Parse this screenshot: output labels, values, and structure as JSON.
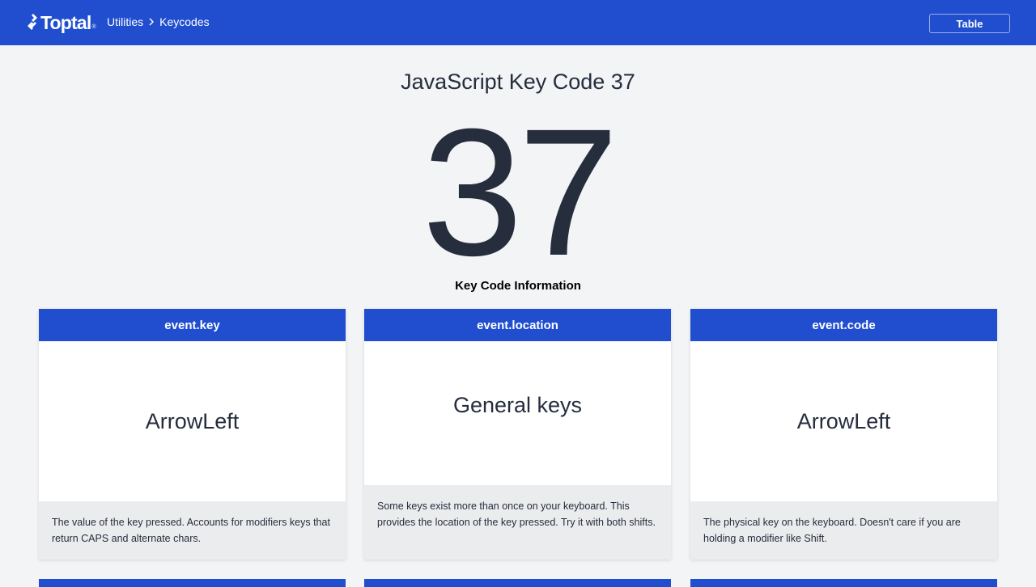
{
  "header": {
    "logo_text": "Toptal",
    "logo_reg": "®",
    "breadcrumb": [
      "Utilities",
      "Keycodes"
    ],
    "table_button": "Table"
  },
  "main": {
    "title": "JavaScript Key Code 37",
    "key_code": "37",
    "section_label": "Key Code Information"
  },
  "cards": [
    {
      "heading": "event.key",
      "value": "ArrowLeft",
      "description": "The value of the key pressed. Accounts for modifiers keys that return CAPS and alternate chars."
    },
    {
      "heading": "event.location",
      "value": "General keys",
      "description": "Some keys exist more than once on your keyboard. This provides the location of the key pressed. Try it with both shifts."
    },
    {
      "heading": "event.code",
      "value": "ArrowLeft",
      "description": "The physical key on the keyboard. Doesn't care if you are holding a modifier like Shift."
    }
  ],
  "colors": {
    "brand_blue": "#204ecf",
    "page_bg": "#f2f4f6",
    "text_dark": "#262d3d",
    "card_footer_bg": "#ebecee"
  },
  "icons": {
    "logo": "toptal-logo-icon",
    "breadcrumb_separator": "chevron-right-icon"
  }
}
